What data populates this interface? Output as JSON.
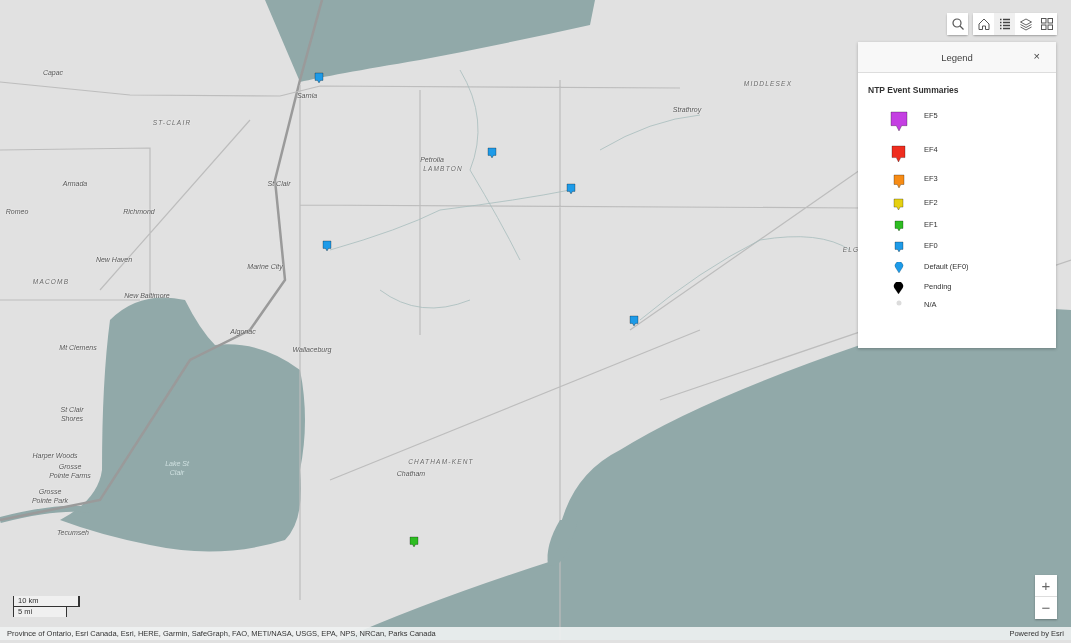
{
  "toolbar": {
    "buttons": [
      {
        "kind": "search",
        "selected": false
      },
      {
        "kind": "home",
        "selected": false
      },
      {
        "kind": "legend",
        "selected": true
      },
      {
        "kind": "layers",
        "selected": false
      },
      {
        "kind": "basemap",
        "selected": false
      }
    ]
  },
  "legend": {
    "title": "Legend",
    "close": "×",
    "layer": "NTP Event Summaries",
    "items": [
      {
        "label": "EF5",
        "color": "#c43fe2",
        "kind": "square-pin"
      },
      {
        "label": "EF4",
        "color": "#ef2d1f",
        "kind": "square-pin"
      },
      {
        "label": "EF3",
        "color": "#f78c15",
        "kind": "square-pin"
      },
      {
        "label": "EF2",
        "color": "#e6d112",
        "kind": "square-pin"
      },
      {
        "label": "EF1",
        "color": "#2ebd22",
        "kind": "square-pin"
      },
      {
        "label": "EF0",
        "color": "#1e9be8",
        "kind": "square-pin"
      },
      {
        "label": "Default (EF0)",
        "color": "#1e9be8",
        "kind": "round-pin"
      },
      {
        "label": "Pending",
        "color": "#000000",
        "kind": "round-pin"
      },
      {
        "label": "N/A",
        "color": "#dcdcdc",
        "kind": "dot"
      }
    ]
  },
  "map": {
    "labels": [
      {
        "text": "Capac",
        "kind": "place"
      },
      {
        "text": "ST-CLAIR",
        "kind": "region"
      },
      {
        "text": "Sarnia",
        "kind": "place"
      },
      {
        "text": "Armada",
        "kind": "place"
      },
      {
        "text": "Richmond",
        "kind": "place"
      },
      {
        "text": "St Clair",
        "kind": "place"
      },
      {
        "text": "Romeo",
        "kind": "place"
      },
      {
        "text": "New Haven",
        "kind": "place"
      },
      {
        "text": "Marine City",
        "kind": "place"
      },
      {
        "text": "MACOMB",
        "kind": "region"
      },
      {
        "text": "New Baltimore",
        "kind": "place"
      },
      {
        "text": "Mt Clemens",
        "kind": "place"
      },
      {
        "text": "Algonac",
        "kind": "place"
      },
      {
        "text": "Wallaceburg",
        "kind": "place"
      },
      {
        "text": "Petrolia",
        "kind": "place"
      },
      {
        "text": "LAMBTON",
        "kind": "region"
      },
      {
        "text": "Strathroy",
        "kind": "place"
      },
      {
        "text": "MIDDLESEX",
        "kind": "region"
      },
      {
        "text": "ELG",
        "kind": "region"
      },
      {
        "text": "St Clair Shores",
        "kind": "place"
      },
      {
        "text": "Harper Woods",
        "kind": "place"
      },
      {
        "text": "Grosse Pointe Farms",
        "kind": "place"
      },
      {
        "text": "Grosse Pointe Park",
        "kind": "place"
      },
      {
        "text": "Lake St Clair",
        "kind": "water"
      },
      {
        "text": "Tecumseh",
        "kind": "place"
      },
      {
        "text": "CHATHAM-KENT",
        "kind": "region"
      },
      {
        "text": "Chatham",
        "kind": "place"
      }
    ],
    "markers": [
      {
        "color": "#1e9be8"
      },
      {
        "color": "#1e9be8"
      },
      {
        "color": "#1e9be8"
      },
      {
        "color": "#1e9be8"
      },
      {
        "color": "#1e9be8"
      },
      {
        "color": "#2ebd22"
      }
    ]
  },
  "scale_bar": {
    "metric": "10 km",
    "imperial": "5 mi"
  },
  "zoom": {
    "zoom_in": "+",
    "zoom_out": "−"
  },
  "attribution": {
    "sources": "Province of Ontario, Esri Canada, Esri, HERE, Garmin, SafeGraph, FAO, METI/NASA, USGS, EPA, NPS, NRCan, Parks Canada",
    "powered_by": "Powered by Esri"
  }
}
